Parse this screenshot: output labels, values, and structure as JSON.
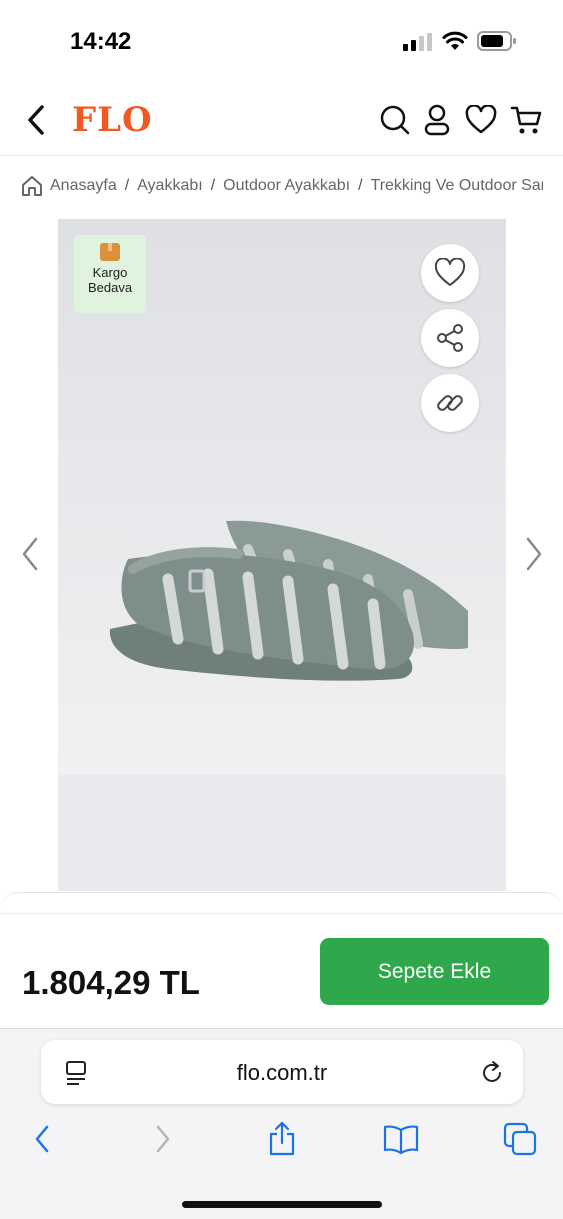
{
  "status_bar": {
    "time": "14:42"
  },
  "header": {
    "logo": "FLO"
  },
  "breadcrumb": {
    "items": [
      "Anasayfa",
      "Ayakkabı",
      "Outdoor Ayakkabı",
      "Trekking Ve Outdoor Sandalet"
    ],
    "separator": "/"
  },
  "product": {
    "badge_line1": "Kargo",
    "badge_line2": "Bedava",
    "badge_color": "#dff3df"
  },
  "price_panel": {
    "price": "1.804,29 TL",
    "add_to_cart": "Sepete Ekle",
    "button_color": "#2ea84a"
  },
  "browser": {
    "url": "flo.com.tr"
  },
  "colors": {
    "brand": "#f05a22",
    "product_gray": "#7e8e8a"
  }
}
